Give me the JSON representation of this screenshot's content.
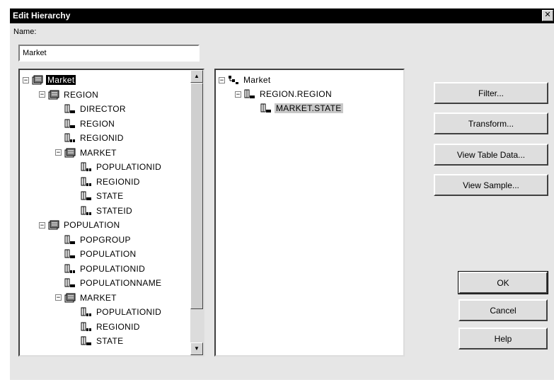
{
  "window": {
    "title": "Edit Hierarchy",
    "close_glyph": "✕"
  },
  "name_field": {
    "label": "Name:",
    "value": "Market"
  },
  "source_tree": {
    "nodes": [
      {
        "label": "Market",
        "kind": "dimension",
        "level": 0,
        "expander": "−",
        "selected": true
      },
      {
        "label": "REGION",
        "kind": "dimension",
        "level": 1,
        "expander": "−"
      },
      {
        "label": "DIRECTOR",
        "kind": "text-column",
        "level": 2
      },
      {
        "label": "REGION",
        "kind": "text-column",
        "level": 2
      },
      {
        "label": "REGIONID",
        "kind": "int-column",
        "level": 2
      },
      {
        "label": "MARKET",
        "kind": "dimension",
        "level": 2,
        "expander": "−"
      },
      {
        "label": "POPULATIONID",
        "kind": "int-column",
        "level": 3
      },
      {
        "label": "REGIONID",
        "kind": "int-column",
        "level": 3
      },
      {
        "label": "STATE",
        "kind": "text-column",
        "level": 3
      },
      {
        "label": "STATEID",
        "kind": "int-column",
        "level": 3
      },
      {
        "label": "POPULATION",
        "kind": "dimension",
        "level": 1,
        "expander": "−"
      },
      {
        "label": "POPGROUP",
        "kind": "text-column",
        "level": 2
      },
      {
        "label": "POPULATION",
        "kind": "text-column",
        "level": 2
      },
      {
        "label": "POPULATIONID",
        "kind": "int-column",
        "level": 2
      },
      {
        "label": "POPULATIONNAME",
        "kind": "text-column",
        "level": 2
      },
      {
        "label": "MARKET",
        "kind": "dimension",
        "level": 2,
        "expander": "−"
      },
      {
        "label": "POPULATIONID",
        "kind": "int-column",
        "level": 3
      },
      {
        "label": "REGIONID",
        "kind": "int-column",
        "level": 3
      },
      {
        "label": "STATE",
        "kind": "text-column",
        "level": 3
      }
    ]
  },
  "hierarchy_tree": {
    "nodes": [
      {
        "label": "Market",
        "kind": "hierarchy",
        "level": 0,
        "expander": "−"
      },
      {
        "label": "REGION.REGION",
        "kind": "text-column",
        "level": 1,
        "expander": "−"
      },
      {
        "label": "MARKET.STATE",
        "kind": "text-column",
        "level": 2,
        "highlight": true
      }
    ]
  },
  "scrollbar": {
    "up_glyph": "▲",
    "down_glyph": "▼"
  },
  "buttons": {
    "filter": "Filter...",
    "transform": "Transform...",
    "view_table_data": "View Table Data...",
    "view_sample": "View Sample...",
    "ok": "OK",
    "cancel": "Cancel",
    "help": "Help"
  },
  "colors": {
    "title_bar": "#000000",
    "dialog_bg": "#e6e6e6",
    "selection": "#000000"
  }
}
